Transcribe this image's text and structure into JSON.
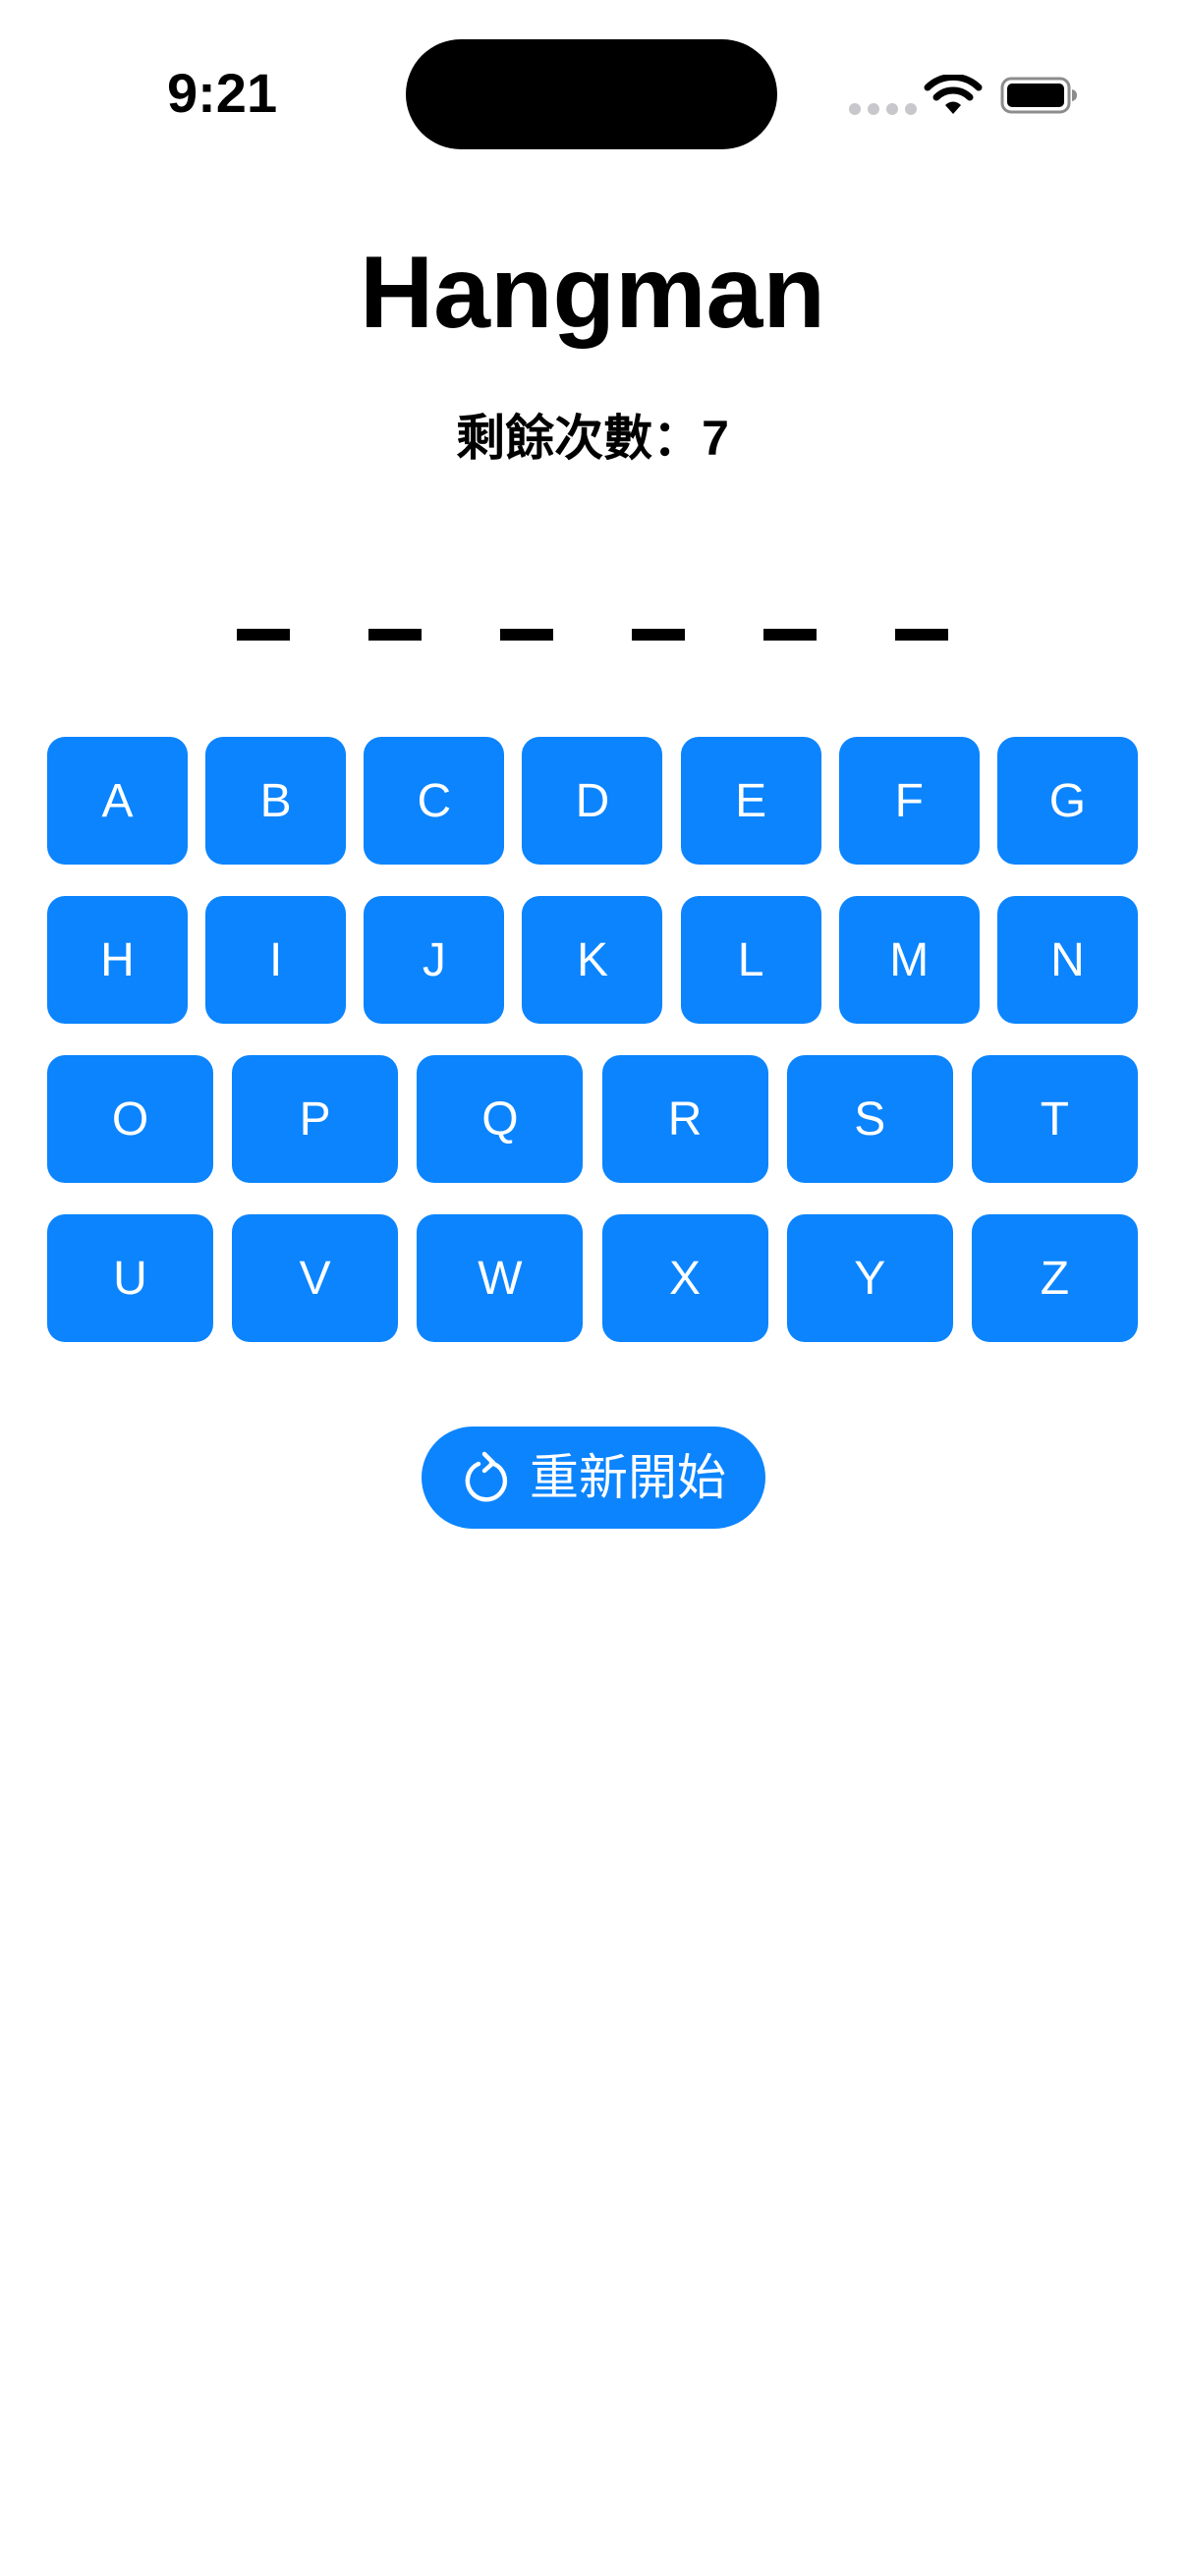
{
  "status_bar": {
    "time": "9:21",
    "icons": [
      "signal-dots-icon",
      "wifi-icon",
      "battery-icon"
    ]
  },
  "header": {
    "title": "Hangman",
    "remaining_label": "剩餘次數：7"
  },
  "word": {
    "slots": [
      "",
      "",
      "",
      "",
      "",
      ""
    ]
  },
  "keyboard": {
    "rows": [
      [
        "A",
        "B",
        "C",
        "D",
        "E",
        "F",
        "G"
      ],
      [
        "H",
        "I",
        "J",
        "K",
        "L",
        "M",
        "N"
      ],
      [
        "O",
        "P",
        "Q",
        "R",
        "S",
        "T"
      ],
      [
        "U",
        "V",
        "W",
        "X",
        "Y",
        "Z"
      ]
    ]
  },
  "restart": {
    "label": "重新開始",
    "icon": "restart-icon"
  },
  "colors": {
    "accent": "#0b84fe",
    "text": "#000000",
    "background": "#ffffff"
  }
}
